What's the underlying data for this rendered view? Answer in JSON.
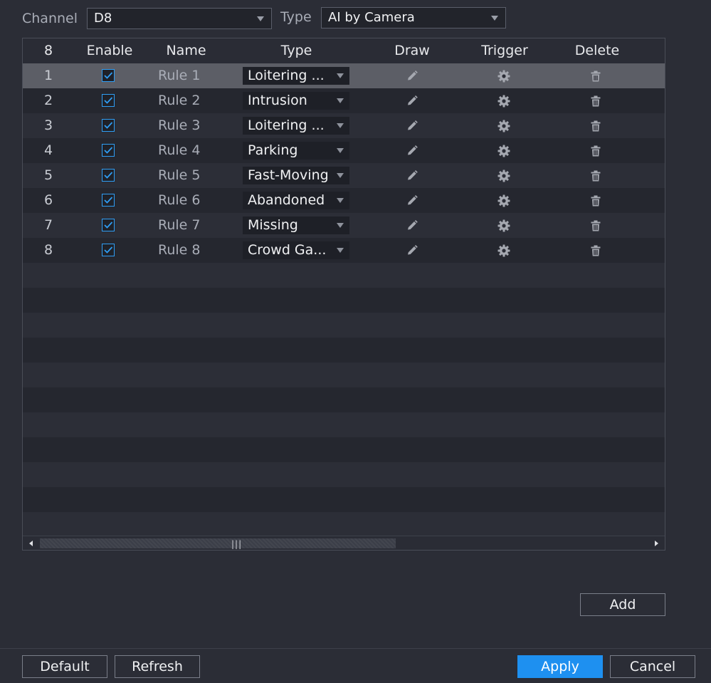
{
  "filters": {
    "channel_label": "Channel",
    "channel_value": "D8",
    "type_label": "Type",
    "type_value": "AI by Camera"
  },
  "table": {
    "headers": {
      "count": "8",
      "enable": "Enable",
      "name": "Name",
      "type": "Type",
      "draw": "Draw",
      "trigger": "Trigger",
      "delete": "Delete"
    },
    "rows": [
      {
        "num": "1",
        "enabled": true,
        "name": "Rule 1",
        "type": "Loitering ...",
        "selected": true
      },
      {
        "num": "2",
        "enabled": true,
        "name": "Rule 2",
        "type": "Intrusion",
        "selected": false
      },
      {
        "num": "3",
        "enabled": true,
        "name": "Rule 3",
        "type": "Loitering ...",
        "selected": false
      },
      {
        "num": "4",
        "enabled": true,
        "name": "Rule 4",
        "type": "Parking",
        "selected": false
      },
      {
        "num": "5",
        "enabled": true,
        "name": "Rule 5",
        "type": "Fast-Moving",
        "selected": false
      },
      {
        "num": "6",
        "enabled": true,
        "name": "Rule 6",
        "type": "Abandoned",
        "selected": false
      },
      {
        "num": "7",
        "enabled": true,
        "name": "Rule 7",
        "type": "Missing",
        "selected": false
      },
      {
        "num": "8",
        "enabled": true,
        "name": "Rule 8",
        "type": "Crowd Ga...",
        "selected": false
      }
    ],
    "icons": {
      "draw": "pencil-icon",
      "trigger": "gear-icon",
      "delete": "trash-icon"
    }
  },
  "actions": {
    "add": "Add",
    "default": "Default",
    "refresh": "Refresh",
    "apply": "Apply",
    "cancel": "Cancel"
  },
  "colors": {
    "accent": "#1e90f0",
    "background": "#2b2d36",
    "selected_row": "#5c5e66",
    "checkbox": "#2f9ef5"
  }
}
